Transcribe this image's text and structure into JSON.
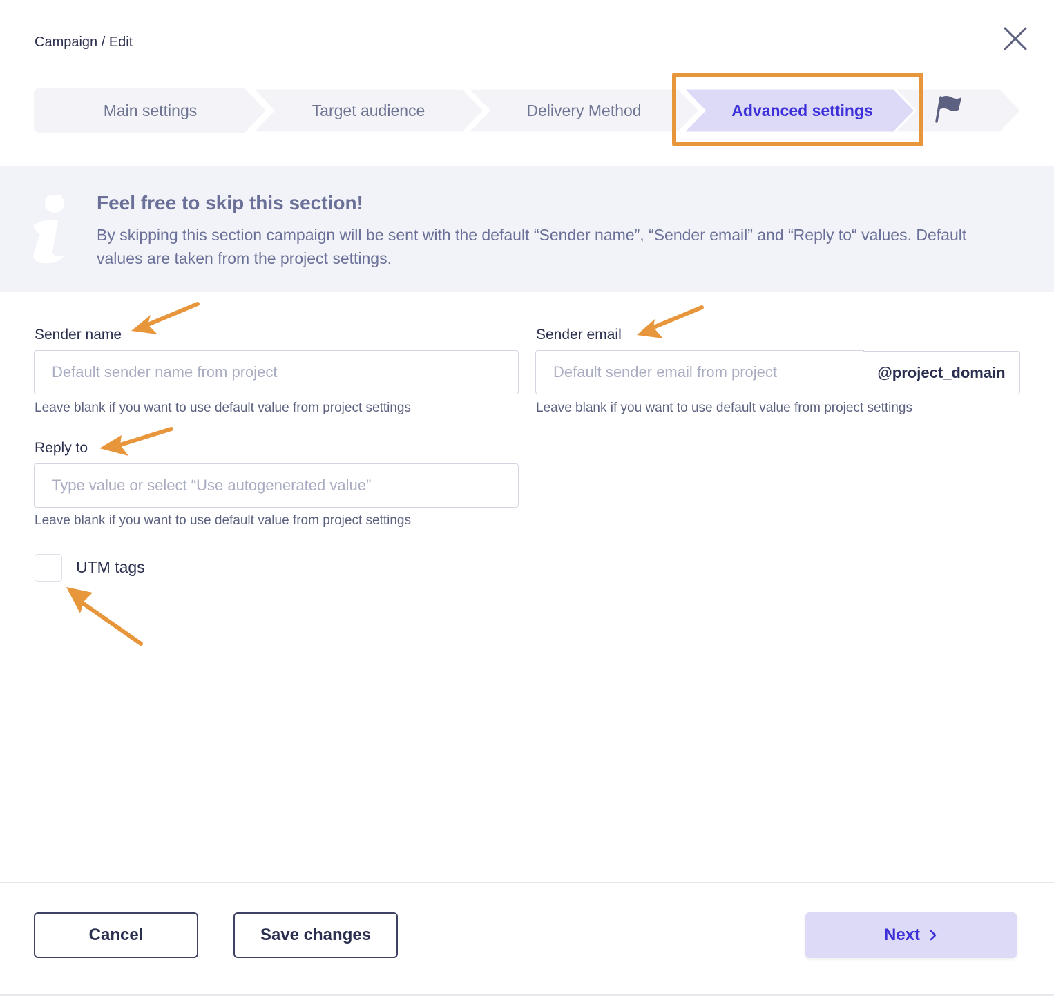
{
  "header": {
    "breadcrumb": "Campaign / Edit",
    "close_icon": "close-icon"
  },
  "steps": [
    {
      "label": "Main settings",
      "state": "inactive"
    },
    {
      "label": "Target audience",
      "state": "inactive"
    },
    {
      "label": "Delivery Method",
      "state": "inactive"
    },
    {
      "label": "Advanced settings",
      "state": "active"
    },
    {
      "label": "",
      "icon": "flag-icon",
      "state": "inactive"
    }
  ],
  "info": {
    "icon": "info-icon",
    "title": "Feel free to skip this section!",
    "text": "By skipping this section campaign will be sent with the default “Sender name”, “Sender email” and “Reply to“ values. Default values are taken from the project settings."
  },
  "form": {
    "sender_name": {
      "label": "Sender name",
      "value": "",
      "placeholder": "Default sender name from project",
      "help": "Leave blank if you want to use default value from project settings"
    },
    "sender_email": {
      "label": "Sender email",
      "value": "",
      "placeholder": "Default sender email from project",
      "addon": "@project_domain",
      "help": "Leave blank if you want to use default value from project settings"
    },
    "reply_to": {
      "label": "Reply to",
      "value": "",
      "placeholder": "Type value or select “Use autogenerated value”",
      "help": "Leave blank if you want to use default value from project settings"
    },
    "utm_tags": {
      "label": "UTM tags",
      "checked": false
    }
  },
  "footer": {
    "cancel_label": "Cancel",
    "save_label": "Save changes",
    "next_label": "Next"
  },
  "colors": {
    "accent": "#3d30d9",
    "active_step_bg": "#dcdaf7",
    "annotation": "#e8963b",
    "banner_bg": "#f2f3f8",
    "step_bg": "#f4f4f8"
  }
}
